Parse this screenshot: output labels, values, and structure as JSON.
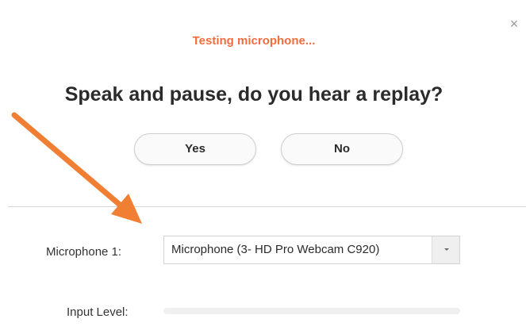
{
  "dialog": {
    "close_glyph": "×",
    "status": "Testing microphone...",
    "question": "Speak and pause, do you hear a replay?",
    "buttons": {
      "yes": "Yes",
      "no": "No"
    }
  },
  "microphone": {
    "label": "Microphone 1:",
    "selected": "Microphone (3- HD Pro Webcam C920)",
    "dropdown_icon": "chevron-down-icon"
  },
  "input_level": {
    "label": "Input Level:",
    "level_fraction": 0
  },
  "colors": {
    "accent": "#f26d3d",
    "annotation_arrow": "#f07f33",
    "text": "#2b2b2b"
  }
}
